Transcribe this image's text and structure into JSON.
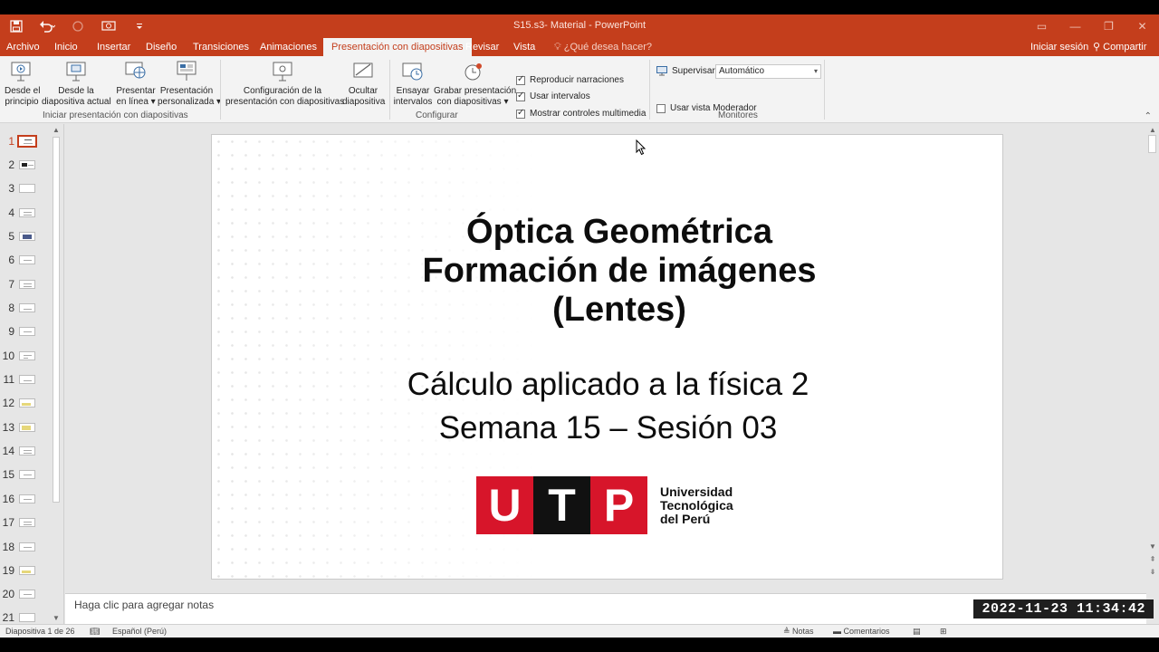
{
  "window": {
    "title": "S15.s3- Material - PowerPoint"
  },
  "tabs": [
    {
      "label": "Archivo"
    },
    {
      "label": "Inicio"
    },
    {
      "label": "Insertar"
    },
    {
      "label": "Diseño"
    },
    {
      "label": "Transiciones"
    },
    {
      "label": "Animaciones"
    },
    {
      "label": "Presentación con diapositivas"
    },
    {
      "label": "Revisar"
    },
    {
      "label": "Vista"
    },
    {
      "label": "¿Qué desea hacer?"
    }
  ],
  "account": {
    "signin": "Iniciar sesión",
    "share": "Compartir"
  },
  "ribbon": {
    "start_group": {
      "label": "Iniciar presentación con diapositivas",
      "from_beginning": [
        "Desde el",
        "principio"
      ],
      "from_current": [
        "Desde la",
        "diapositiva actual"
      ],
      "online": [
        "Presentar",
        "en línea"
      ],
      "custom": [
        "Presentación",
        "personalizada"
      ]
    },
    "configure_group": {
      "label": "Configurar",
      "setup": [
        "Configuración de la",
        "presentación con diapositivas"
      ],
      "hide": [
        "Ocultar",
        "diapositiva"
      ],
      "rehearse": [
        "Ensayar",
        "intervalos"
      ],
      "record": [
        "Grabar presentación",
        "con diapositivas"
      ],
      "play_narrations": "Reproducir narraciones",
      "use_timings": "Usar intervalos",
      "show_media_controls": "Mostrar controles multimedia"
    },
    "monitors_group": {
      "label": "Monitores",
      "monitor_label": "Supervisar:",
      "monitor_value": "Automático",
      "presenter_view": "Usar vista Moderador"
    }
  },
  "thumbnails": [
    "1",
    "2",
    "3",
    "4",
    "5",
    "6",
    "7",
    "8",
    "9",
    "10",
    "11",
    "12",
    "13",
    "14",
    "15",
    "16",
    "17",
    "18",
    "19",
    "20",
    "21"
  ],
  "slide": {
    "title_lines": [
      "Óptica Geométrica",
      "Formación de imágenes",
      "(Lentes)"
    ],
    "subtitle_lines": [
      "Cálculo aplicado a la física 2",
      "Semana 15 – Sesión 03"
    ],
    "logo_letters": [
      "U",
      "T",
      "P"
    ],
    "logo_text": [
      "Universidad",
      "Tecnológica",
      "del Perú"
    ]
  },
  "notes_placeholder": "Haga clic para agregar notas",
  "status": {
    "slide_count": "Diapositiva 1 de 26",
    "language": "Español (Perú)",
    "notes": "Notas",
    "comments": "Comentarios"
  },
  "timestamp": "2022-11-23  11:34:42",
  "colors": {
    "accent": "#c43e1c",
    "utp_red": "#d7152a"
  }
}
